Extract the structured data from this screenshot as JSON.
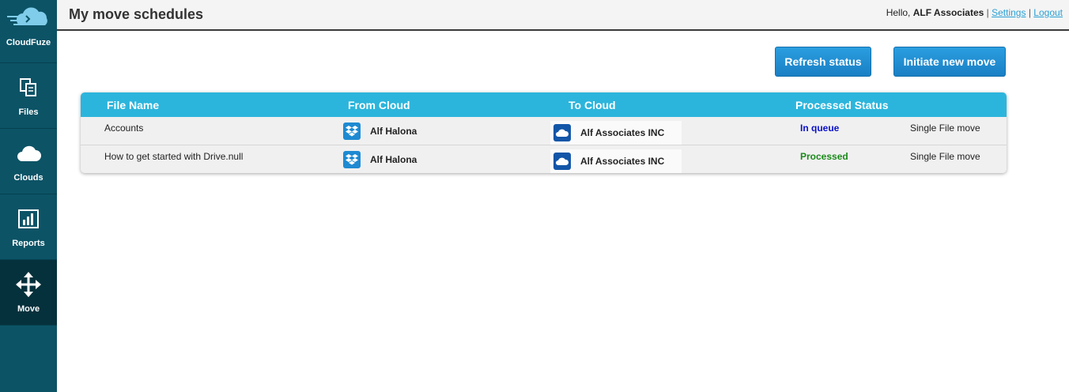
{
  "brand": {
    "name": "CloudFuze"
  },
  "sidebar": {
    "items": [
      {
        "label": "Files",
        "icon": "files-icon"
      },
      {
        "label": "Clouds",
        "icon": "cloud-icon"
      },
      {
        "label": "Reports",
        "icon": "reports-icon"
      },
      {
        "label": "Move",
        "icon": "move-icon",
        "active": true
      }
    ]
  },
  "header": {
    "title": "My move schedules",
    "greeting": "Hello,",
    "user_name": "ALF Associates",
    "separator": "|",
    "settings_label": "Settings",
    "logout_label": "Logout"
  },
  "actions": {
    "refresh_label": "Refresh status",
    "initiate_label": "Initiate new move"
  },
  "table": {
    "columns": [
      "File Name",
      "From Cloud",
      "To Cloud",
      "Processed Status"
    ],
    "rows": [
      {
        "file_name": "Accounts",
        "from_cloud": "Alf Halona",
        "from_icon": "dropbox-icon",
        "to_cloud": "Alf Associates INC",
        "to_icon": "onedrive-icon",
        "status": "In queue",
        "move_type": "Single File move"
      },
      {
        "file_name": "How to get started with Drive.null",
        "from_cloud": "Alf Halona",
        "from_icon": "dropbox-icon",
        "to_cloud": "Alf Associates INC",
        "to_icon": "onedrive-icon",
        "status": "Processed",
        "move_type": "Single File move"
      }
    ]
  },
  "colors": {
    "sidebar_bg": "#0c5366",
    "header_bar": "#2cb5dc",
    "button": "#1a7fc4",
    "status_in_queue": "#0a10c8",
    "status_processed": "#1a8a1a"
  }
}
